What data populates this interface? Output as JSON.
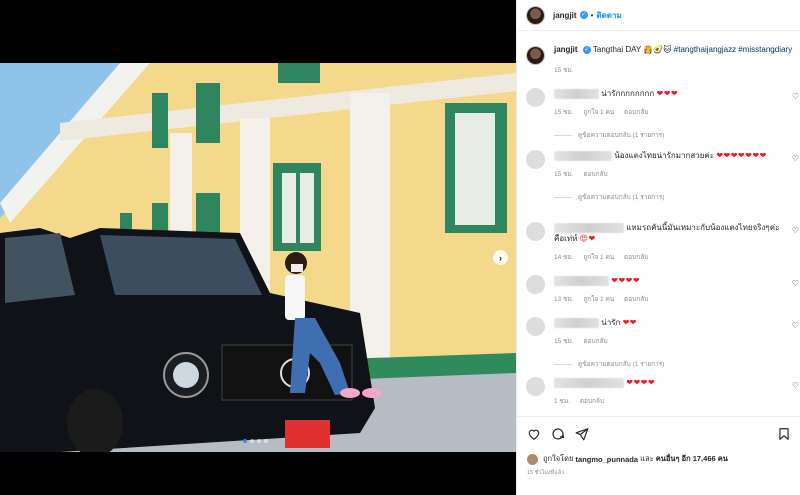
{
  "post": {
    "username": "jangjit",
    "follow_sep": "•",
    "follow_label": "ติดตาม"
  },
  "caption": {
    "username": "jangjit",
    "text": "Tangthai DAY",
    "hashtags": "#tangthaijangjazz #misstangdiary",
    "time": "15 ชม."
  },
  "comments": [
    {
      "text": "น่ารักกกกกกกก",
      "hearts": "❤❤❤",
      "time": "15 ชม.",
      "likes": "ถูกใจ 1 คน",
      "reply": "ตอบกลับ",
      "view_replies": "ดูข้อความตอบกลับ (1 รายการ)"
    },
    {
      "text": "น้องแตงไทยน่ารักมากสวยค่ะ",
      "hearts": "❤❤❤❤❤❤❤",
      "time": "15 ชม.",
      "reply": "ตอบกลับ",
      "view_replies": "ดูข้อความตอบกลับ (1 รายการ)"
    },
    {
      "text": "แหมรถคันนี้มันเหมาะกับน้องแตงไทยจริงๆค่ะ คือเท่ห์",
      "hearts": "😍❤",
      "time": "14 ชม.",
      "likes": "ถูกใจ 1 คน",
      "reply": "ตอบกลับ"
    },
    {
      "text": "",
      "hearts": "❤❤❤❤",
      "time": "13 ชม.",
      "likes": "ถูกใจ 1 คน",
      "reply": "ตอบกลับ"
    },
    {
      "text": "น่ารัก",
      "hearts": "❤❤",
      "time": "15 ชม.",
      "reply": "ตอบกลับ",
      "view_replies": "ดูข้อความตอบกลับ (1 รายการ)"
    },
    {
      "text": "",
      "hearts": "❤❤❤❤",
      "time": "1 ชม.",
      "reply": "ตอบกลับ"
    }
  ],
  "liked_by": {
    "prefix": "ถูกใจโดย",
    "user": "tangmo_punnada",
    "suffix": "และ",
    "others": "คนอื่นๆ อีก 17,466 คน"
  },
  "posted_ago": "15 ชั่วโมงที่แล้ว",
  "icons": {
    "like": "heart-icon",
    "comment": "comment-icon",
    "share": "share-icon",
    "save": "bookmark-icon",
    "next": "chevron-right-icon"
  },
  "colors": {
    "link": "#0095f6",
    "hashtag": "#00376b",
    "heart": "#ed1c24",
    "verified": "#3897f0"
  }
}
